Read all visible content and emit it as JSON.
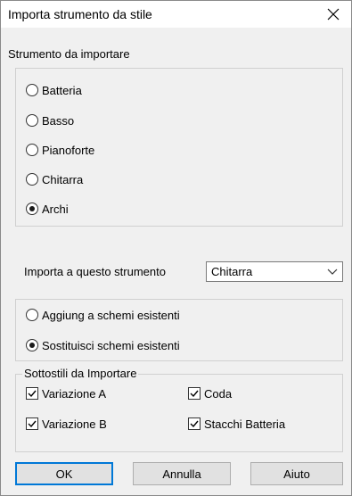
{
  "window": {
    "title": "Importa strumento da stile"
  },
  "instrument_group": {
    "label": "Strumento da importare",
    "options": [
      {
        "label": "Batteria",
        "selected": false
      },
      {
        "label": "Basso",
        "selected": false
      },
      {
        "label": "Pianoforte",
        "selected": false
      },
      {
        "label": "Chitarra",
        "selected": false
      },
      {
        "label": "Archi",
        "selected": true
      }
    ]
  },
  "import_to": {
    "label": "Importa a questo strumento",
    "value": "Chitarra"
  },
  "mode_group": {
    "options": [
      {
        "label": "Aggiung a schemi esistenti",
        "selected": false
      },
      {
        "label": "Sostituisci schemi esistenti",
        "selected": true
      }
    ]
  },
  "substyles": {
    "label": "Sottostili da Importare",
    "items": [
      {
        "label": "Variazione A",
        "checked": true
      },
      {
        "label": "Coda",
        "checked": true
      },
      {
        "label": "Variazione B",
        "checked": true
      },
      {
        "label": "Stacchi Batteria",
        "checked": true
      }
    ]
  },
  "buttons": {
    "ok": "OK",
    "cancel": "Annulla",
    "help": "Aiuto"
  }
}
